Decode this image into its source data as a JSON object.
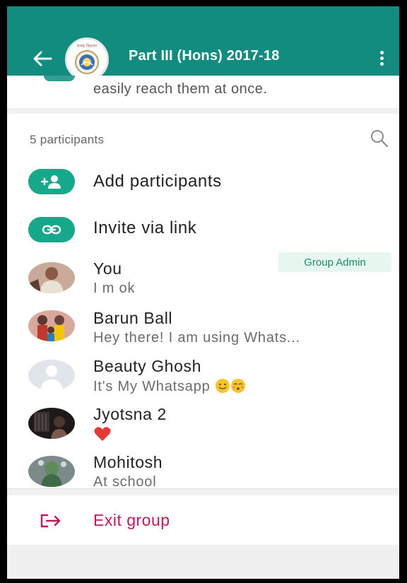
{
  "header": {
    "title": "Part III (Hons) 2017-18",
    "avatar_caption": "নগর বিভাগ"
  },
  "description": {
    "text": "easily reach them at once."
  },
  "participants": {
    "count_label": "5 participants",
    "actions": [
      {
        "label": "Add participants",
        "icon": "add-person-icon"
      },
      {
        "label": "Invite via link",
        "icon": "link-icon"
      }
    ],
    "admin_badge": "Group Admin",
    "list": [
      {
        "name": "You",
        "status": "I m ok"
      },
      {
        "name": "Barun Ball",
        "status": "Hey there! I am using Whats..."
      },
      {
        "name": "Beauty Ghosh",
        "status": "It's My Whatsapp"
      },
      {
        "name": "Jyotsna 2",
        "status": ""
      },
      {
        "name": "Mohitosh",
        "status": "At school"
      }
    ]
  },
  "exit": {
    "label": "Exit group"
  },
  "colors": {
    "accent": "#128c7e",
    "icon_green": "#17a88b",
    "exit": "#c2185b"
  }
}
